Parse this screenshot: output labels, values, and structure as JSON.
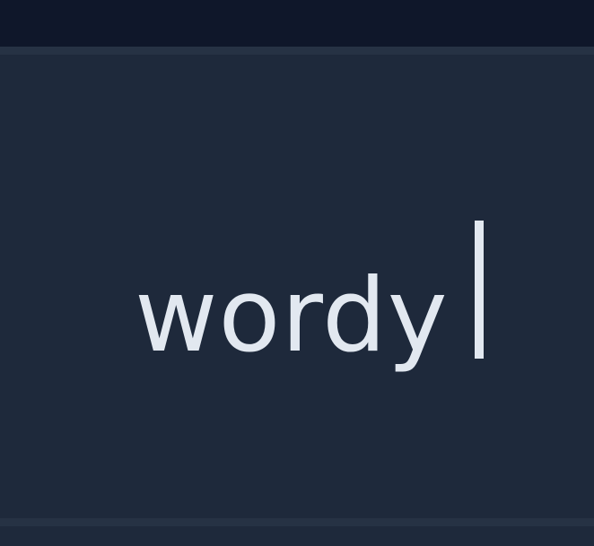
{
  "editor": {
    "text": "wordy"
  },
  "colors": {
    "background": "#0f172a",
    "panel": "#1e293b",
    "panel_border": "#263244",
    "text": "#e2e8f0"
  }
}
